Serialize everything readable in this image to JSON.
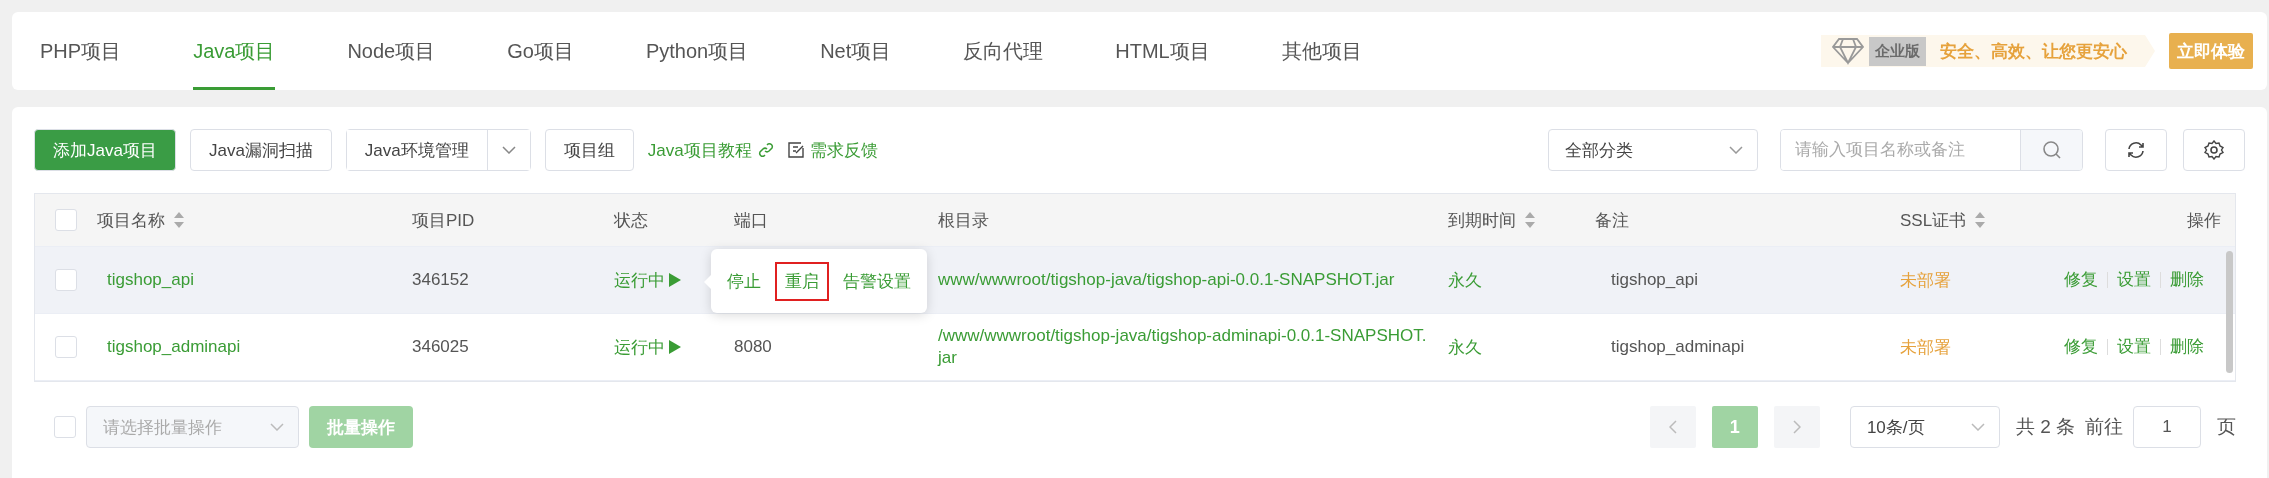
{
  "tabs": [
    {
      "label": "PHP项目",
      "selected": false
    },
    {
      "label": "Java项目",
      "selected": true
    },
    {
      "label": "Node项目",
      "selected": false
    },
    {
      "label": "Go项目",
      "selected": false
    },
    {
      "label": "Python项目",
      "selected": false
    },
    {
      "label": "Net项目",
      "selected": false
    },
    {
      "label": "反向代理",
      "selected": false
    },
    {
      "label": "HTML项目",
      "selected": false
    },
    {
      "label": "其他项目",
      "selected": false
    }
  ],
  "promo": {
    "tag": "企业版",
    "text": "安全、高效、让您更安心",
    "button": "立即体验"
  },
  "toolbar": {
    "primary": "添加Java项目",
    "scan": "Java漏洞扫描",
    "env": "Java环境管理",
    "group": "项目组",
    "tutorial": "Java项目教程",
    "feedback": "需求反馈",
    "category": "全部分类",
    "search_placeholder": "请输入项目名称或备注"
  },
  "table": {
    "header_checked": false,
    "columns": [
      {
        "label": "项目名称",
        "sortable": true
      },
      {
        "label": "项目PID",
        "sortable": false
      },
      {
        "label": "状态",
        "sortable": false
      },
      {
        "label": "端口",
        "sortable": false
      },
      {
        "label": "根目录",
        "sortable": false
      },
      {
        "label": "到期时间",
        "sortable": true
      },
      {
        "label": "备注",
        "sortable": false
      },
      {
        "label": "SSL证书",
        "sortable": true
      },
      {
        "label": "操作",
        "sortable": false
      }
    ],
    "rows": [
      {
        "checked": false,
        "hovered": true,
        "name": "tigshop_api",
        "pid": "346152",
        "status": "运行中",
        "root": "www/wwwroot/tigshop-java/tigshop-api-0.0.1-SNAPSHOT.jar",
        "expiry": "永久",
        "note": "tigshop_api",
        "ssl": "未部署",
        "actions": [
          "修复",
          "设置",
          "删除"
        ]
      },
      {
        "checked": false,
        "hovered": false,
        "name": "tigshop_adminapi",
        "pid": "346025",
        "status": "运行中",
        "port": "8080",
        "root": "/www/wwwroot/tigshop-java/tigshop-adminapi-0.0.1-SNAPSHOT.jar",
        "expiry": "永久",
        "note": "tigshop_adminapi",
        "ssl": "未部署",
        "actions": [
          "修复",
          "设置",
          "删除"
        ]
      }
    ]
  },
  "popover": {
    "items": [
      {
        "label": "停止",
        "highlighted": false
      },
      {
        "label": "重启",
        "highlighted": true
      },
      {
        "label": "告警设置",
        "highlighted": false
      }
    ]
  },
  "footer": {
    "checked": false,
    "batch_placeholder": "请选择批量操作",
    "batch_button": "批量操作",
    "pages": [
      {
        "label": "1",
        "selected": true
      }
    ],
    "page_size": "10条/页",
    "total": "共 2 条",
    "goto": "前往",
    "page_input": "1",
    "page_unit": "页"
  }
}
